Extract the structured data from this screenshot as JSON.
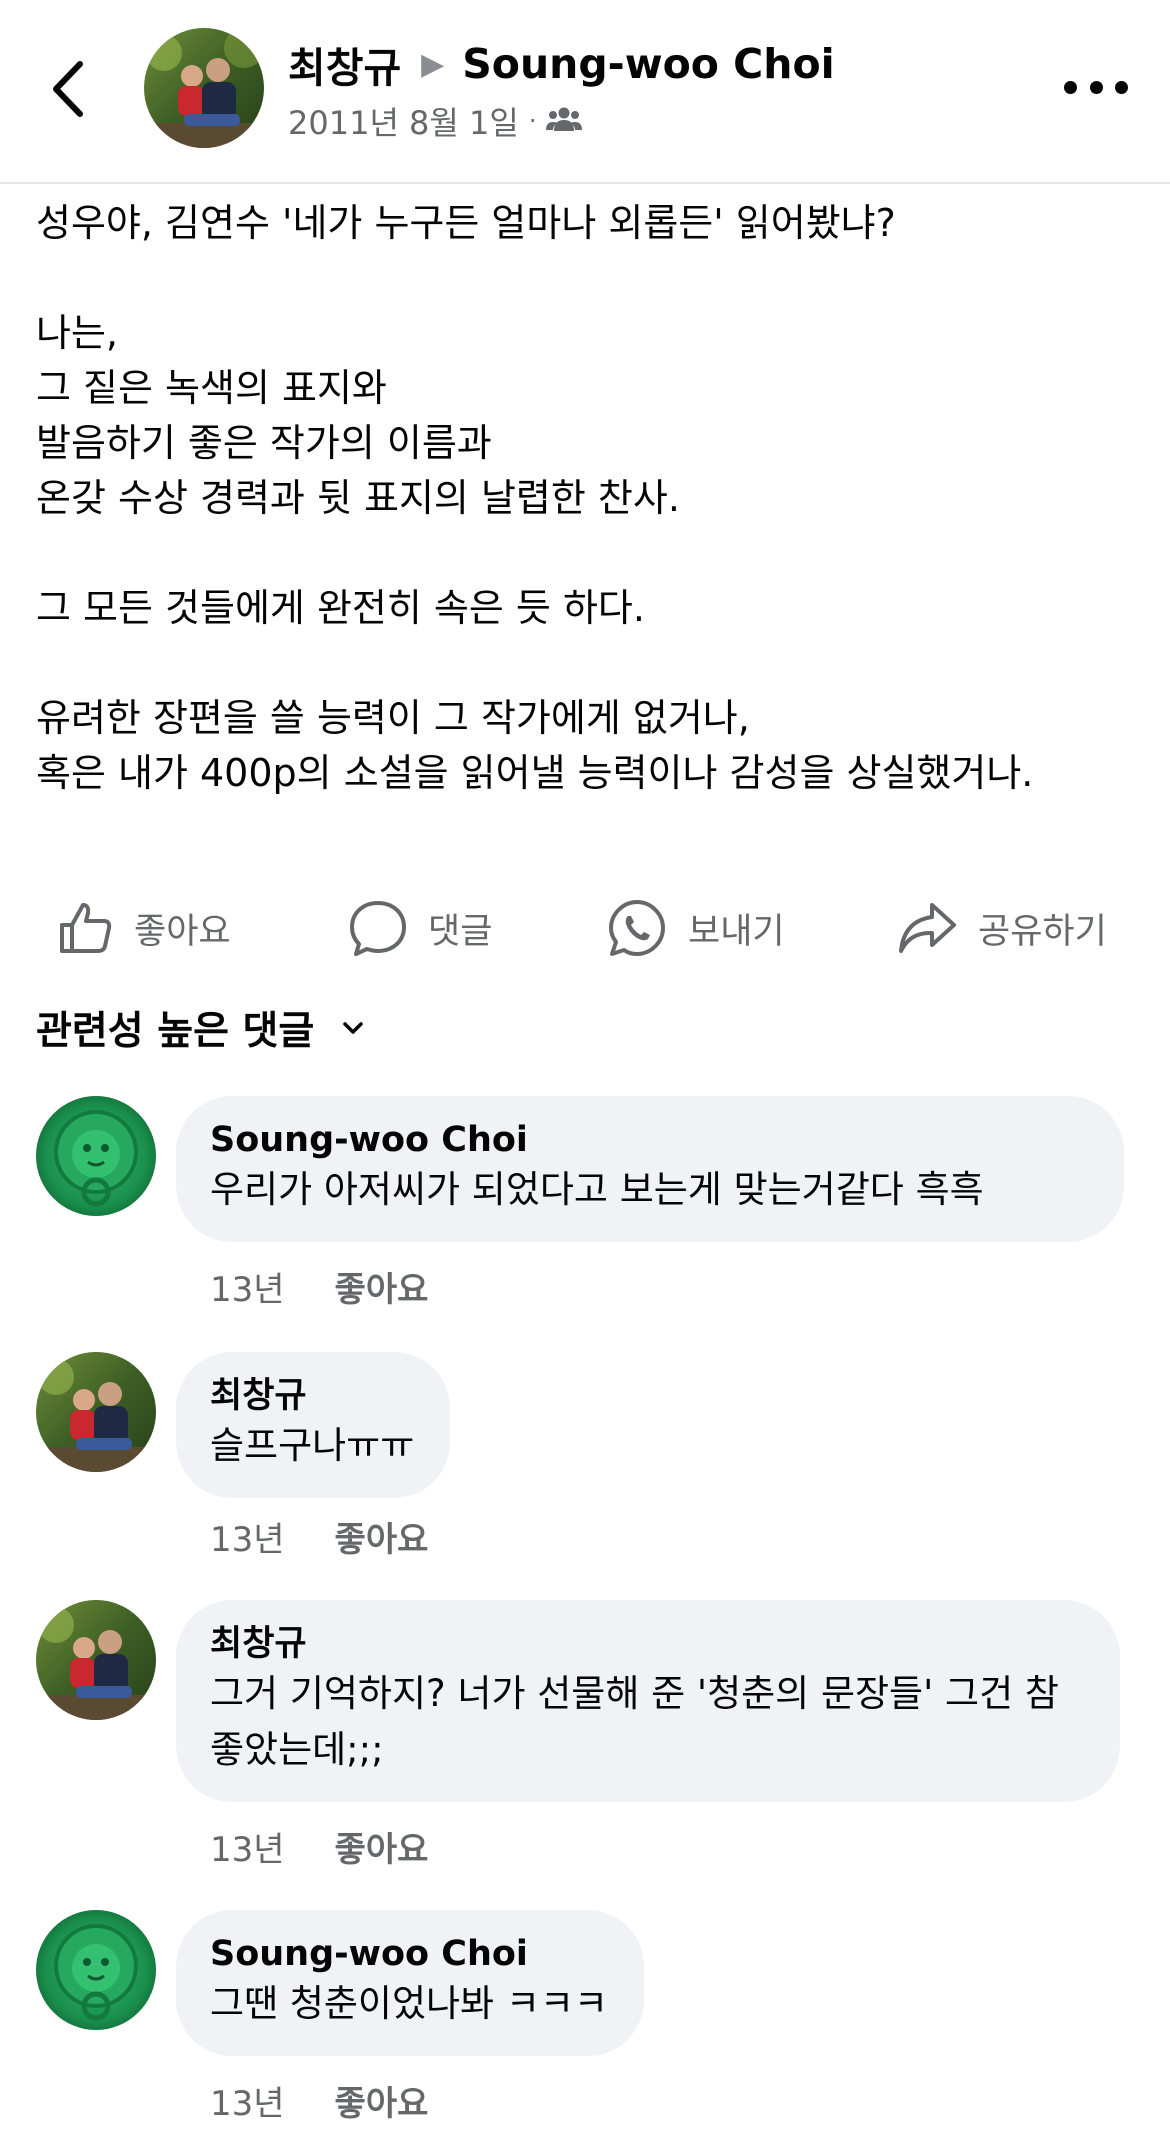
{
  "header": {
    "author": "최창규",
    "recipient": "Soung-woo Choi",
    "date": "2011년 8월 1일",
    "audience_icon": "friends-icon",
    "more_icon": "more-options-icon",
    "back_icon": "back-chevron-icon"
  },
  "post": {
    "text": "성우야, 김연수 '네가 누구든 얼마나 외롭든' 읽어봤냐?\n\n나는,\n그 짙은 녹색의 표지와\n발음하기 좋은 작가의 이름과\n온갖 수상 경력과 뒷 표지의 날렵한 찬사.\n\n그 모든 것들에게 완전히 속은 듯 하다.\n\n유려한 장편을 쓸 능력이 그 작가에게 없거나,\n혹은 내가 400p의 소설을 읽어낼 능력이나 감성을 상실했거나."
  },
  "actions": {
    "like": "좋아요",
    "comment": "댓글",
    "send": "보내기",
    "share": "공유하기"
  },
  "comments_sort": "관련성 높은 댓글",
  "comments": [
    {
      "author": "Soung-woo Choi",
      "text": "우리가 아저씨가 되었다고 보는게 맞는거같다 흑흑",
      "time": "13년",
      "like": "좋아요",
      "avatar": "lion-avatar"
    },
    {
      "author": "최창규",
      "text": "슬프구나ㅠㅠ",
      "time": "13년",
      "like": "좋아요",
      "avatar": "couple-photo-avatar"
    },
    {
      "author": "최창규",
      "text": "그거 기억하지? 너가 선물해 준 '청춘의 문장들' 그건 참 좋았는데;;;",
      "time": "13년",
      "like": "좋아요",
      "avatar": "couple-photo-avatar"
    },
    {
      "author": "Soung-woo Choi",
      "text": "그땐 청춘이었나봐 ㅋㅋㅋ",
      "time": "13년",
      "like": "좋아요",
      "avatar": "lion-avatar"
    }
  ],
  "colors": {
    "text": "#050505",
    "secondary": "#65676b",
    "bubble": "#f0f2f5",
    "lion_green": "#1f9a55"
  }
}
